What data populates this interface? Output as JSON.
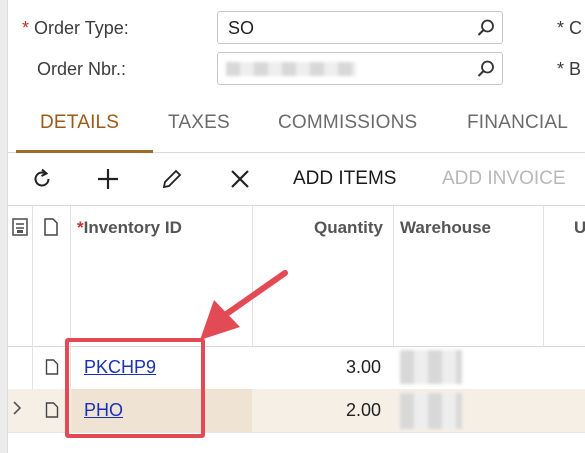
{
  "form": {
    "order_type_label": "Order Type:",
    "order_type_value": "SO",
    "order_nbr_label": "Order Nbr.:",
    "right_label_1": "C",
    "right_label_2": "B",
    "required_mark": "*"
  },
  "tabs": [
    {
      "label": "DETAILS",
      "active": true
    },
    {
      "label": "TAXES",
      "active": false
    },
    {
      "label": "COMMISSIONS",
      "active": false
    },
    {
      "label": "FINANCIAL",
      "active": false
    }
  ],
  "toolbar": {
    "refresh_icon": "refresh-icon",
    "add_icon": "plus-icon",
    "edit_icon": "pencil-icon",
    "delete_icon": "close-icon",
    "add_items_label": "ADD ITEMS",
    "add_invoice_label": "ADD INVOICE"
  },
  "grid": {
    "columns": {
      "inventory_id": "Inventory ID",
      "quantity": "Quantity",
      "warehouse": "Warehouse",
      "partial": "U"
    },
    "rows": [
      {
        "inventory_id": "PKCHP9",
        "quantity": "3.00",
        "selected": false
      },
      {
        "inventory_id": "PHO",
        "quantity": "2.00",
        "selected": true
      }
    ]
  },
  "colors": {
    "accent": "#9a5b17",
    "link": "#1a31b6",
    "highlight": "#e24a55"
  }
}
